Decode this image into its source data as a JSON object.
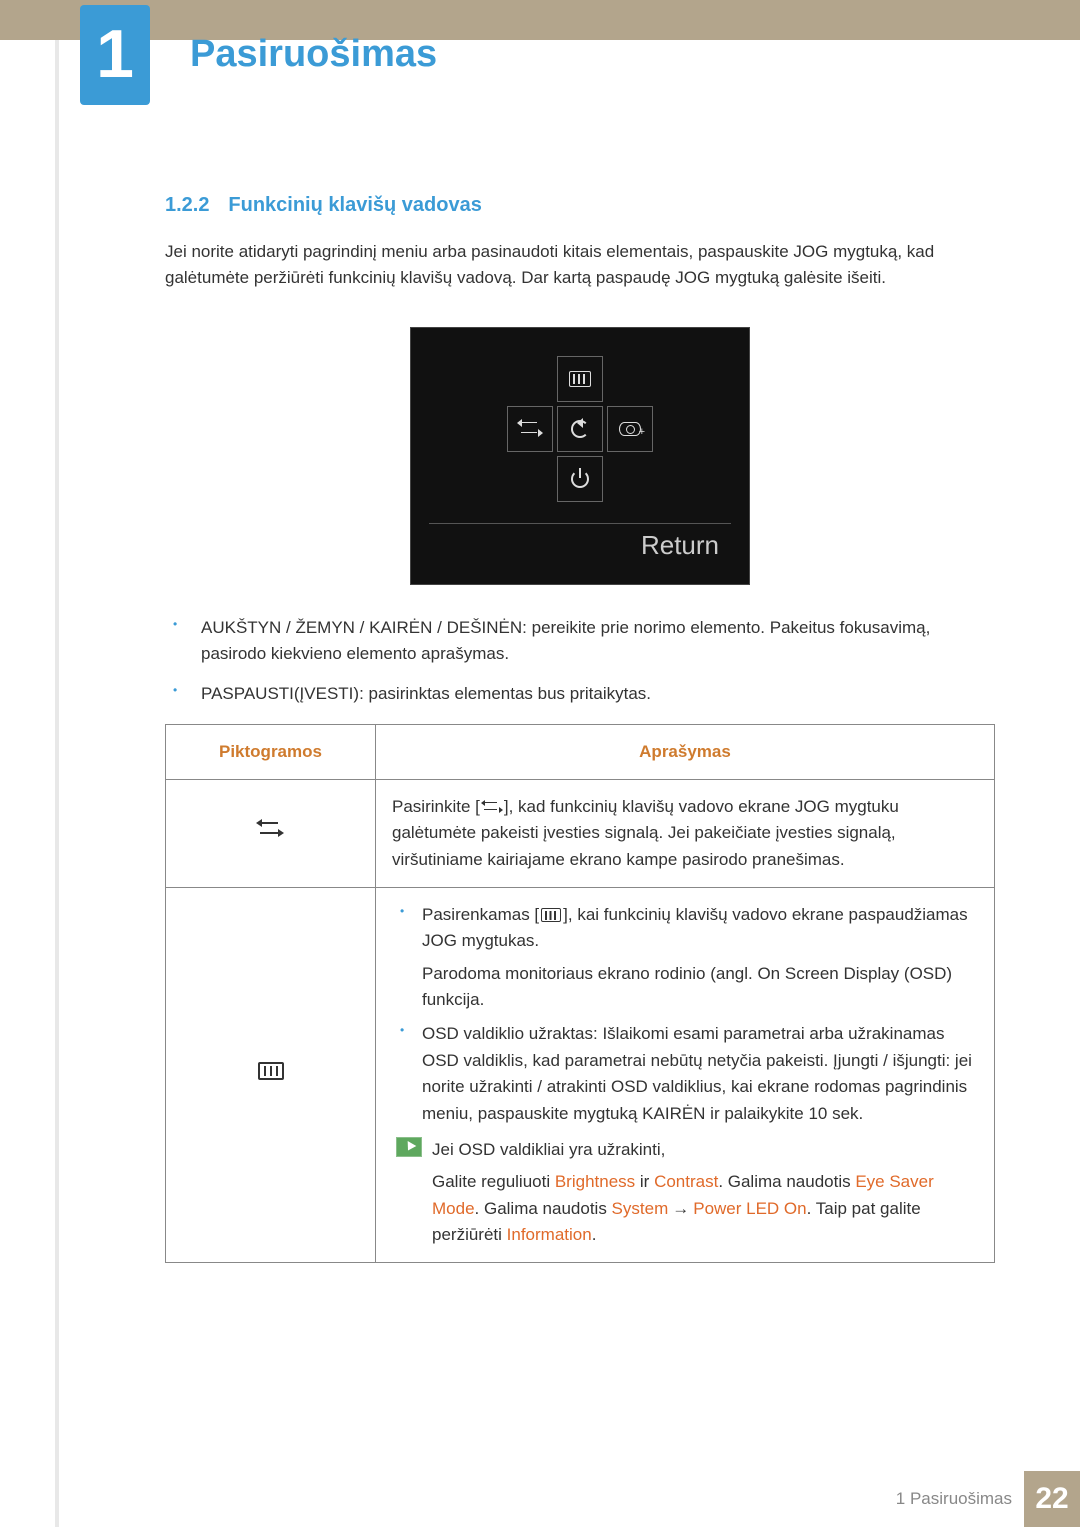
{
  "chapter": {
    "number": "1",
    "title": "Pasiruošimas"
  },
  "section": {
    "number": "1.2.2",
    "title": "Funkcinių klavišų vadovas"
  },
  "intro": "Jei norite atidaryti pagrindinį meniu arba pasinaudoti kitais elementais, paspauskite JOG mygtuką, kad galėtumėte peržiūrėti funkcinių klavišų vadovą. Dar kartą paspaudę JOG mygtuką galėsite išeiti.",
  "osd": {
    "return_label": "Return"
  },
  "bullets": [
    "AUKŠTYN / ŽEMYN / KAIRĖN / DEŠINĖN: pereikite prie norimo elemento. Pakeitus fokusavimą, pasirodo kiekvieno elemento aprašymas.",
    "PASPAUSTI(ĮVESTI): pasirinktas elementas bus pritaikytas."
  ],
  "table": {
    "headers": {
      "icons": "Piktogramos",
      "desc": "Aprašymas"
    },
    "row1": {
      "pre": "Pasirinkite [",
      "post": "], kad funkcinių klavišų vadovo ekrane JOG mygtuku galėtumėte pakeisti įvesties signalą. Jei pakeičiate įvesties signalą, viršutiniame kairiajame ekrano kampe pasirodo pranešimas."
    },
    "row2": {
      "b1_pre": "Pasirenkamas [",
      "b1_post": "], kai funkcinių klavišų vadovo ekrane paspaudžiamas JOG mygtukas.",
      "b1_line2": "Parodoma monitoriaus ekrano rodinio (angl. On Screen Display (OSD) funkcija.",
      "b2": "OSD valdiklio užraktas: Išlaikomi esami parametrai arba užrakinamas OSD valdiklis, kad parametrai nebūtų netyčia pakeisti. Įjungti / išjungti: jei norite užrakinti / atrakinti OSD valdiklius, kai ekrane rodomas pagrindinis meniu, paspauskite mygtuką KAIRĖN ir palaikykite 10 sek.",
      "note_line": "Jei OSD valdikliai yra užrakinti,",
      "note_p": {
        "t1": "Galite reguliuoti ",
        "brightness": "Brightness",
        "and": " ir ",
        "contrast": "Contrast",
        "t2": ". Galima naudotis ",
        "eye": "Eye Saver Mode",
        "t3": ". Galima naudotis ",
        "system": "System",
        "arrow": "→",
        "pled": "Power LED On",
        "t4": ". Taip pat galite peržiūrėti ",
        "info": "Information",
        "t5": "."
      }
    }
  },
  "footer": {
    "text": "1 Pasiruošimas",
    "page": "22"
  }
}
